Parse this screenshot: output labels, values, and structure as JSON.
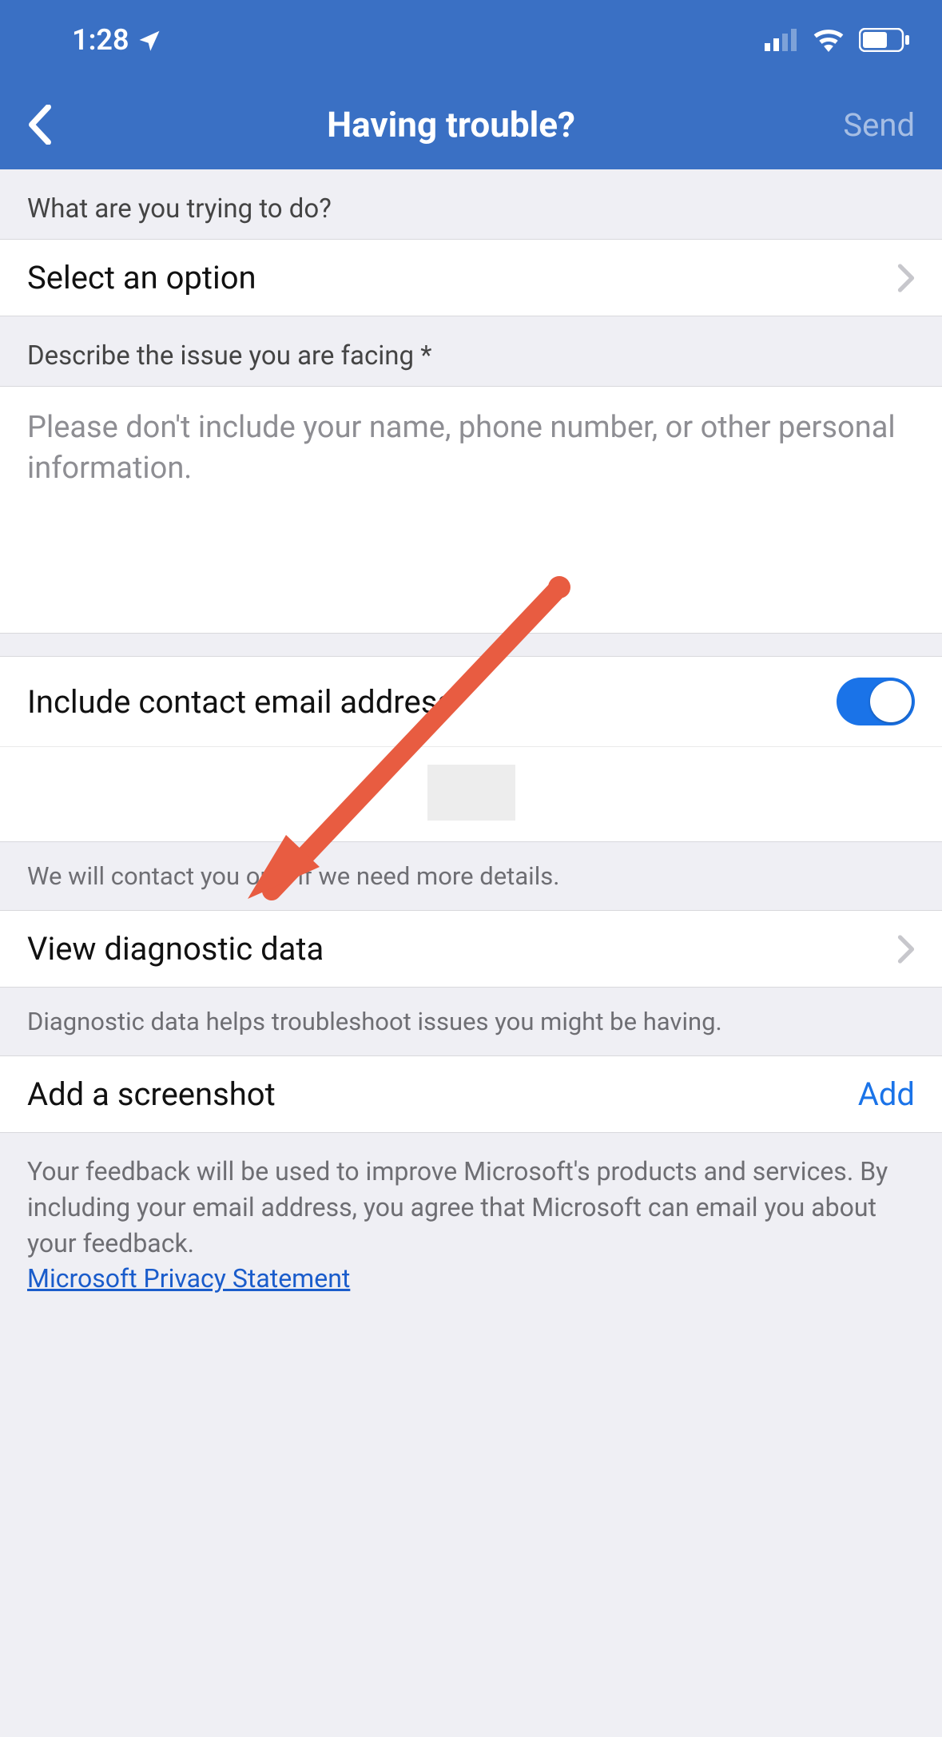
{
  "status": {
    "time": "1:28"
  },
  "nav": {
    "title": "Having trouble?",
    "send": "Send"
  },
  "section1": {
    "label": "What are you trying to do?",
    "select_placeholder": "Select an option"
  },
  "section2": {
    "label": "Describe the issue you are facing *",
    "placeholder": "Please don't include your name, phone number, or other personal information."
  },
  "contact": {
    "toggle_label": "Include contact email address",
    "note": "We will contact you only if we need more details."
  },
  "diagnostic": {
    "label": "View diagnostic data",
    "note": "Diagnostic data helps troubleshoot issues you might be having."
  },
  "screenshot": {
    "label": "Add a screenshot",
    "action": "Add"
  },
  "footer": {
    "text": "Your feedback will be used to improve Microsoft's products and services. By including your email address, you agree that Microsoft can email you about your feedback.",
    "link": "Microsoft Privacy Statement"
  }
}
